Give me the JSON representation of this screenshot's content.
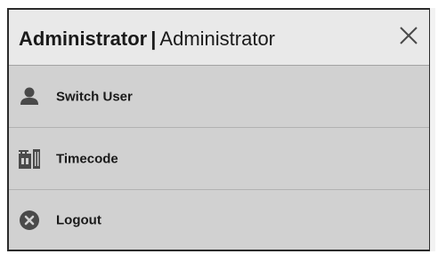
{
  "header": {
    "user_name": "Administrator",
    "separator": "|",
    "role": "Administrator",
    "close_icon": "close-icon"
  },
  "menu": {
    "items": [
      {
        "label": "Switch User",
        "icon": "user-icon"
      },
      {
        "label": "Timecode",
        "icon": "timecode-icon"
      },
      {
        "label": "Logout",
        "icon": "logout-icon"
      }
    ]
  },
  "colors": {
    "header_bg": "#e9e9e9",
    "menu_bg": "#d1d1d1",
    "border": "#2b2b2b",
    "icon": "#4a4a4a"
  }
}
